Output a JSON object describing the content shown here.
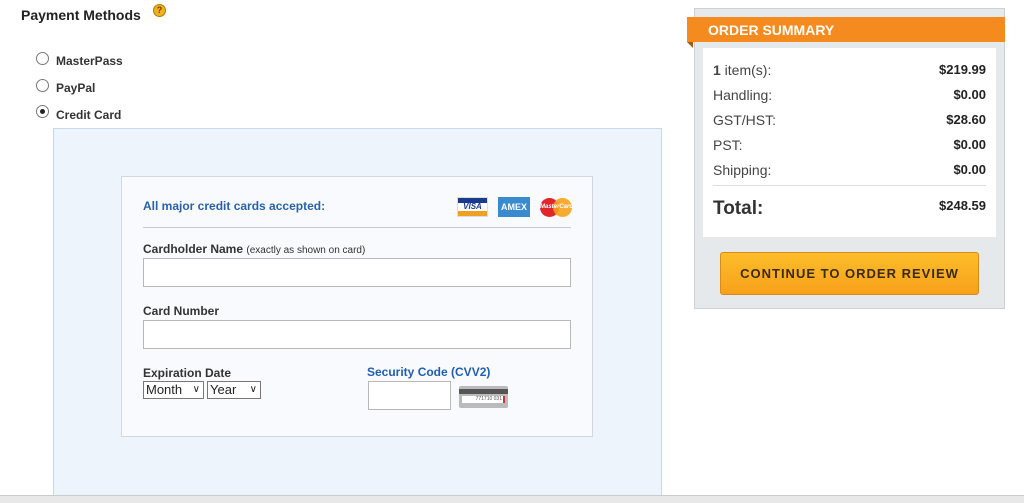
{
  "payment": {
    "title": "Payment Methods",
    "help_icon": "?",
    "options": [
      {
        "label": "MasterPass",
        "selected": false
      },
      {
        "label": "PayPal",
        "selected": false
      },
      {
        "label": "Credit Card",
        "selected": true
      }
    ]
  },
  "card_form": {
    "accepted": "All major credit cards accepted:",
    "brands": [
      "VISA",
      "AMEX",
      "MasterCard"
    ],
    "cardholder_label": "Cardholder Name",
    "cardholder_hint": "(exactly as shown on card)",
    "cardholder_value": "",
    "number_label": "Card Number",
    "number_value": "",
    "expiration_label": "Expiration Date",
    "month": "Month",
    "year": "Year",
    "cvv_label": "Security Code (CVV2)",
    "cvv_value": "",
    "cvv_sample": "771710 031"
  },
  "summary": {
    "title": "ORDER SUMMARY",
    "item_count": "1",
    "item_label": " item(s):",
    "item_value": "$219.99",
    "rows": [
      {
        "label": "Handling:",
        "value": "$0.00"
      },
      {
        "label": "GST/HST:",
        "value": "$28.60"
      },
      {
        "label": "PST:",
        "value": "$0.00"
      },
      {
        "label": "Shipping:",
        "value": "$0.00"
      }
    ],
    "total_label": "Total:",
    "total_value": "$248.59",
    "button": "CONTINUE TO ORDER REVIEW",
    "colors": {
      "header": "#f58a1f",
      "button": "#fdb022"
    }
  }
}
